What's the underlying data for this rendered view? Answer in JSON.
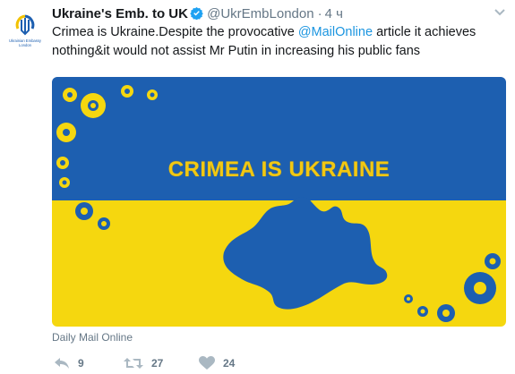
{
  "tweet": {
    "author_name": "Ukraine's Emb. to UK",
    "handle": "@UkrEmbLondon",
    "separator": "·",
    "time": "4 ч",
    "text_parts": {
      "p1": "Crimea is Ukraine.Despite the provocative ",
      "mention": "@MailOnline",
      "p2": " article it achieves nothing&it would not assist Mr Putin in increasing his public fans"
    }
  },
  "avatar": {
    "line1": "Ukrainian Embassy",
    "line2": "London"
  },
  "card": {
    "headline": "CRIMEA IS UKRAINE",
    "source": "Daily Mail Online"
  },
  "actions": {
    "reply_count": "9",
    "retweet_count": "27",
    "like_count": "24"
  },
  "colors": {
    "flag_blue": "#1d5fb0",
    "flag_yellow": "#f5d70f",
    "link_blue": "#1b95e0",
    "muted_gray": "#657786"
  },
  "icons": [
    "verified-badge-icon",
    "chevron-down-icon",
    "reply-icon",
    "retweet-icon",
    "heart-icon",
    "trident-logo-icon"
  ]
}
